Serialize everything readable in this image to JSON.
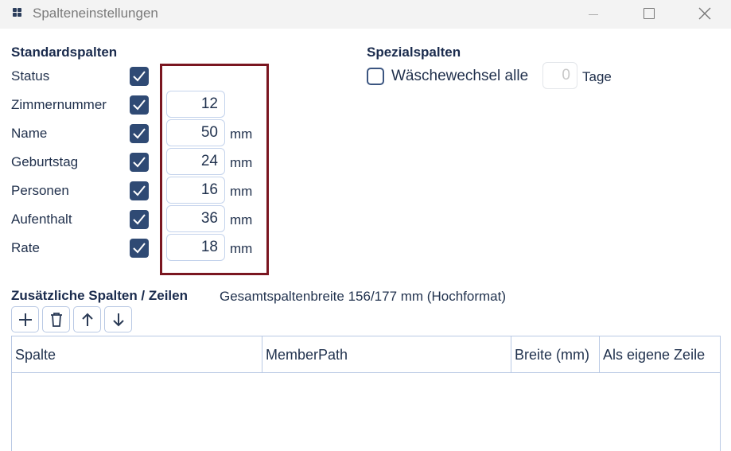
{
  "window": {
    "title": "Spalteneinstellungen",
    "app_icon": "app-logo-icon",
    "minimize_icon": "minimize-icon",
    "maximize_icon": "maximize-icon",
    "close_icon": "close-icon"
  },
  "standard": {
    "title": "Standardspalten",
    "rows": [
      {
        "label": "Status",
        "checked": true
      },
      {
        "label": "Zimmernummer",
        "checked": true,
        "value": "12",
        "unit": ""
      },
      {
        "label": "Name",
        "checked": true,
        "value": "50",
        "unit": "mm"
      },
      {
        "label": "Geburtstag",
        "checked": true,
        "value": "24",
        "unit": "mm"
      },
      {
        "label": "Personen",
        "checked": true,
        "value": "16",
        "unit": "mm"
      },
      {
        "label": "Aufenthalt",
        "checked": true,
        "value": "36",
        "unit": "mm"
      },
      {
        "label": "Rate",
        "checked": true,
        "value": "18",
        "unit": "mm"
      }
    ]
  },
  "special": {
    "title": "Spezialspalten",
    "laundry_label": "Wäschewechsel alle",
    "laundry_checked": false,
    "days_value": "0",
    "days_unit": "Tage"
  },
  "additional": {
    "title": "Zusätzliche Spalten / Zeilen",
    "total_width": "Gesamtspaltenbreite 156/177 mm (Hochformat)",
    "toolbar": [
      "add-icon",
      "delete-icon",
      "arrow-up-icon",
      "arrow-down-icon"
    ],
    "columns": [
      "Spalte",
      "MemberPath",
      "Breite (mm)",
      "Als eigene Zeile"
    ]
  },
  "colors": {
    "accent": "#2f4a74",
    "highlight": "#7a1620",
    "border": "#b9c9e4"
  }
}
